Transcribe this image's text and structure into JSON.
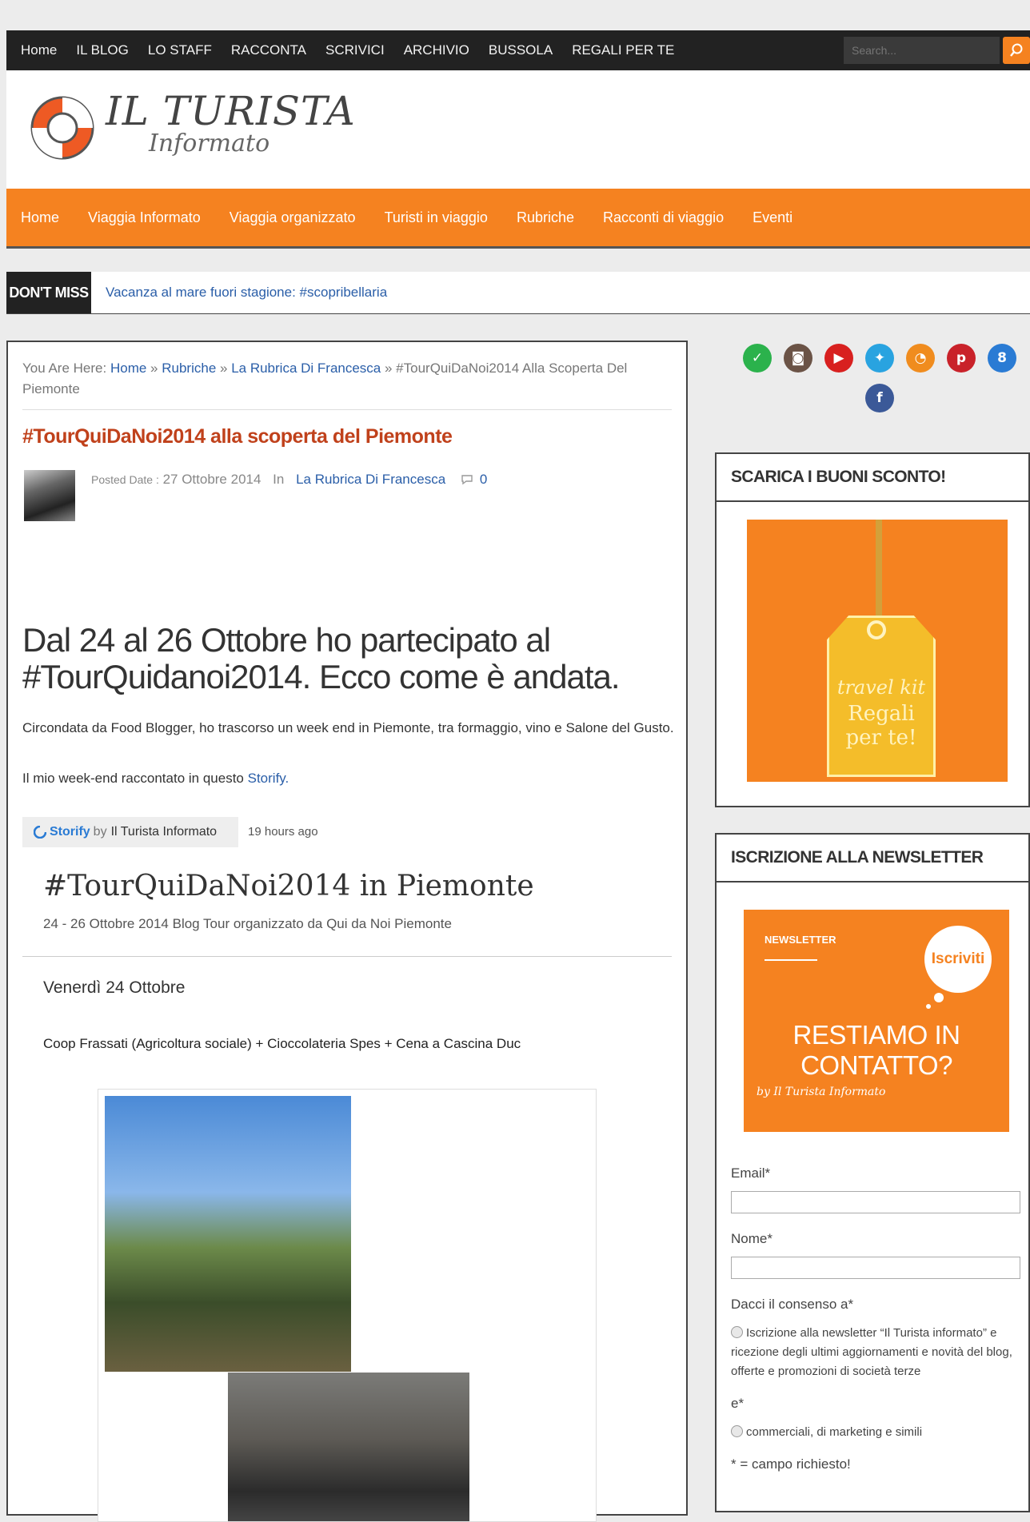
{
  "topbar": {
    "menu": [
      "Home",
      "IL BLOG",
      "LO STAFF",
      "RACCONTA",
      "SCRIVICI",
      "ARCHIVIO",
      "BUSSOLA",
      "REGALI PER TE"
    ],
    "search_placeholder": "Search..."
  },
  "logo": {
    "title": "IL TURISTA",
    "subtitle": "Informato"
  },
  "orangenav": [
    "Home",
    "Viaggia Informato",
    "Viaggia organizzato",
    "Turisti in viaggio",
    "Rubriche",
    "Racconti di viaggio",
    "Eventi"
  ],
  "dontmiss": {
    "label": "DON'T MISS",
    "headline": "Vacanza al mare fuori stagione: #scopribellaria"
  },
  "breadcrumb": {
    "prefix": "You Are Here:",
    "home": "Home",
    "rubriche": "Rubriche",
    "rubrica": "La Rubrica Di Francesca",
    "current": "#TourQuiDaNoi2014 Alla Scoperta Del Piemonte"
  },
  "post": {
    "title": "#TourQuiDaNoi2014 alla scoperta del Piemonte",
    "posted_label": "Posted Date :",
    "date": "27 Ottobre 2014",
    "in_label": "In",
    "category": "La Rubrica Di Francesca",
    "comments": "0",
    "heading": "Dal 24 al 26 Ottobre ho partecipato al #TourQuidanoi2014. Ecco come è andata.",
    "para1": "Circondata da Food Blogger, ho trascorso un week end in Piemonte, tra formaggio, vino e Salone del Gusto.",
    "para2_text": "Il mio week-end raccontato in questo",
    "para2_link": "Storify."
  },
  "storify": {
    "brand": "Storify",
    "by": "by",
    "author": "Il Turista Informato",
    "time": "19 hours ago",
    "title": "#TourQuiDaNoi2014 in Piemonte",
    "subtitle": "24 - 26 Ottobre 2014 Blog Tour organizzato da Qui da Noi Piemonte",
    "day_title": "Venerdì 24 Ottobre",
    "day_desc": "Coop Frassati (Agricoltura sociale) + Cioccolateria Spes + Cena a Cascina Duc"
  },
  "sidebar": {
    "social_icons": [
      "feedly-icon",
      "instagram-icon",
      "youtube-icon",
      "twitter-icon",
      "rss-icon",
      "pinterest-icon",
      "googleplus-icon",
      "facebook-icon"
    ],
    "colors": {
      "feedly": "#2bb24c",
      "instagram": "#6b5346",
      "youtube": "#d8201f",
      "twitter": "#29a3e0",
      "rss": "#f08c1e",
      "pinterest": "#c9222a",
      "googleplus": "#2a7bd4",
      "facebook": "#3b5998"
    },
    "widget1_title": "SCARICA I BUONI SCONTO!",
    "gift_line1": "travel kit",
    "gift_line2": "Regali per te!",
    "widget2_title": "ISCRIZIONE ALLA NEWSLETTER",
    "nl_small": "NEWSLETTER",
    "nl_bubble": "Iscriviti",
    "nl_big": "RESTIAMO IN CONTATTO?",
    "nl_by": "by Il Turista Informato",
    "email_label": "Email*",
    "nome_label": "Nome*",
    "consent_label": "Dacci il consenso a*",
    "consent_text": "Iscrizione alla newsletter “Il Turista informato” e ricezione degli ultimi aggiornamenti e novità del blog, offerte e promozioni di società terze",
    "e_label": "e*",
    "commercial_text": "commerciali, di marketing e simili",
    "required_note": "* = campo richiesto!"
  },
  "accent_color": "#f58220",
  "link_color": "#2a5ea8",
  "title_color": "#c0411b"
}
